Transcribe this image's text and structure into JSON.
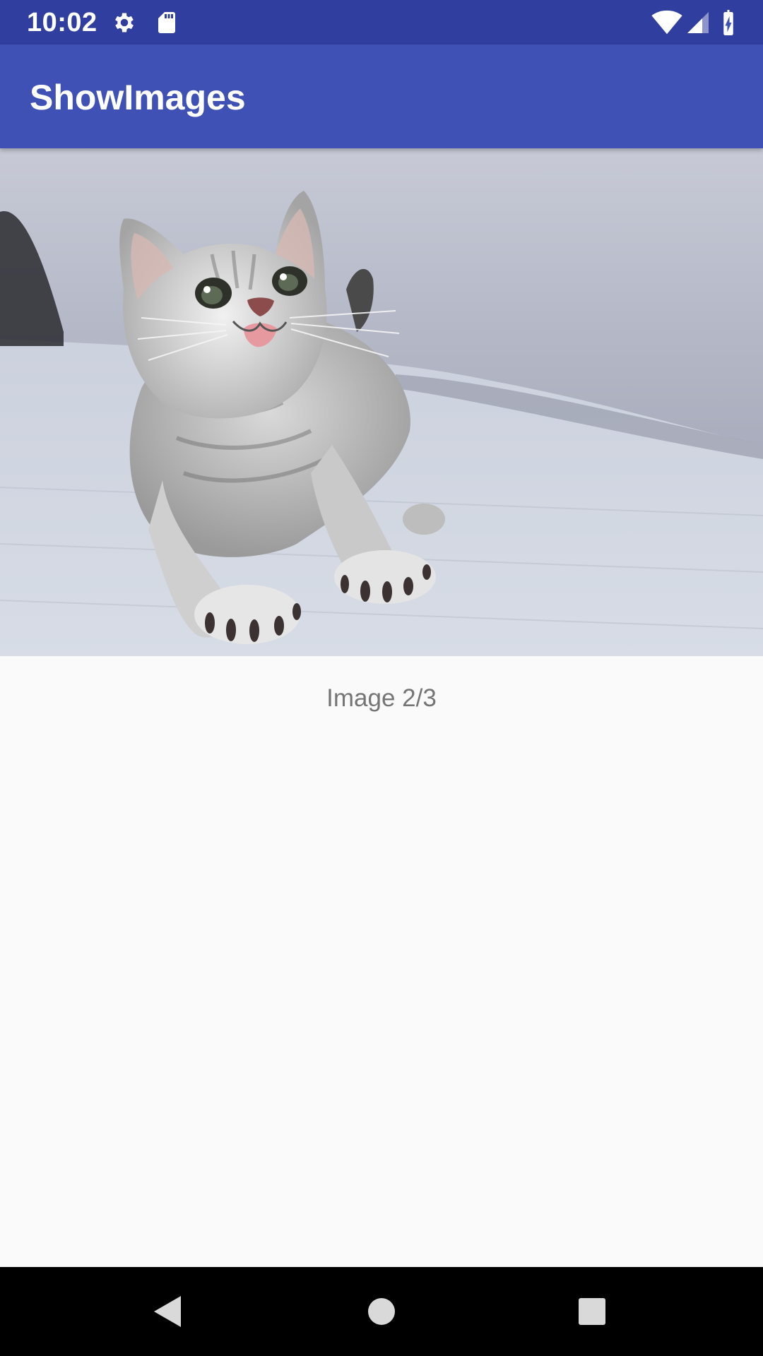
{
  "status_bar": {
    "time": "10:02",
    "icons": [
      "settings-icon",
      "sd-card-icon",
      "wifi-icon",
      "cell-signal-icon",
      "battery-charging-icon"
    ]
  },
  "app_bar": {
    "title": "ShowImages"
  },
  "main": {
    "image_description_icon": "kitten-photo",
    "caption": "Image 2/3"
  },
  "nav_bar": {
    "buttons": [
      "back-icon",
      "home-icon",
      "recents-icon"
    ]
  },
  "colors": {
    "status_bar": "#303f9f",
    "app_bar": "#3f51b5",
    "background": "#fafafa",
    "caption_text": "#757575",
    "nav_bar": "#000000"
  }
}
